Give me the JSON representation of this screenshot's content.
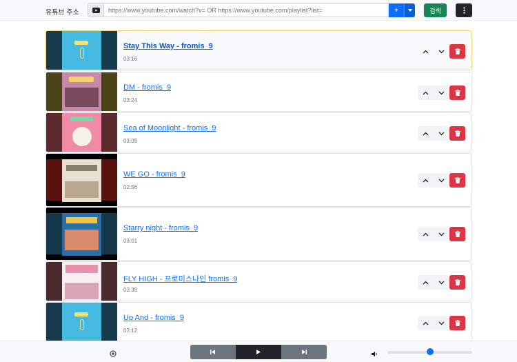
{
  "header": {
    "url_label": "유튜브 주소",
    "url_placeholder": "https://www.youtube.com/watch?v= OR https://www.youtube.com/playlist?list=",
    "add_label": "+",
    "search_label": "검색"
  },
  "playlist": [
    {
      "title": "Stay This Way - fromis_9",
      "duration": "03:16",
      "active": true
    },
    {
      "title": "DM - fromis_9",
      "duration": "03:24",
      "active": false
    },
    {
      "title": "Sea of Moonlight - fromis_9",
      "duration": "03:09",
      "active": false
    },
    {
      "title": "WE GO - fromis_9",
      "duration": "02:56",
      "active": false
    },
    {
      "title": "Starry night - fromis_9",
      "duration": "03:01",
      "active": false
    },
    {
      "title": "FLY HIGH - 프로미스나인 fromis_9",
      "duration": "03:39",
      "active": false
    },
    {
      "title": "Up And - fromis_9",
      "duration": "03:12",
      "active": false
    }
  ],
  "player": {
    "volume_fraction": 0.5
  },
  "colors": {
    "primary": "#0d6efd",
    "success": "#198754",
    "danger": "#dc3545",
    "dark": "#212529",
    "secondary": "#6c757d"
  }
}
